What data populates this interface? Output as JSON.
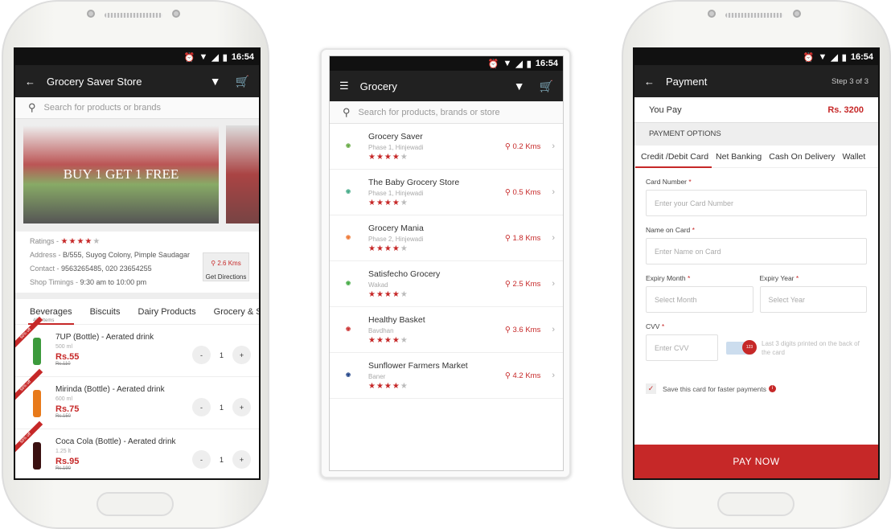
{
  "status_time": "16:54",
  "colors": {
    "accent": "#c62828",
    "appbar": "#212121"
  },
  "store_screen": {
    "title": "Grocery Saver Store",
    "search_placeholder": "Search for products or brands",
    "banner_text": "BUY 1 GET 1 FREE",
    "ratings_label": "Ratings",
    "rating": 4,
    "address_label": "Address",
    "address": "B/555, Suyog Colony, Pimple Saudagar",
    "contact_label": "Contact",
    "contact": "9563265485, 020 23654255",
    "timings_label": "Shop Timings",
    "timings": "9:30 am to 10:00 pm",
    "distance": "2.6 Kms",
    "directions": "Get Directions",
    "tabs": [
      "Beverages",
      "Biscuits",
      "Dairy Products",
      "Grocery & S"
    ],
    "active_tab_count": "400 Items",
    "products": [
      {
        "name": "7UP (Bottle) - Aerated drink",
        "qty": "500 ml",
        "price": "Rs.55",
        "old": "Rs.110",
        "badge": "50% off",
        "count": "1",
        "color": "#3c9a3c"
      },
      {
        "name": "Mirinda (Bottle) - Aerated drink",
        "qty": "600 ml",
        "price": "Rs.75",
        "old": "Rs.150",
        "badge": "50% off",
        "count": "1",
        "color": "#e87a1a"
      },
      {
        "name": "Coca Cola (Bottle) - Aerated drink",
        "qty": "1.25 lt",
        "price": "Rs.95",
        "old": "Rs.190",
        "badge": "50% off",
        "count": "1",
        "color": "#3a1010"
      }
    ],
    "minus": "-",
    "plus": "+"
  },
  "list_screen": {
    "title": "Grocery",
    "search_placeholder": "Search for products, brands or store",
    "stores": [
      {
        "name": "Grocery Saver",
        "area": "Phase 1, Hinjewadi",
        "distance": "0.2 Kms",
        "rating": 4
      },
      {
        "name": "The Baby Grocery Store",
        "area": "Phase 1, Hinjewadi",
        "distance": "0.5 Kms",
        "rating": 4
      },
      {
        "name": "Grocery Mania",
        "area": "Phase 2, Hinjewadi",
        "distance": "1.8 Kms",
        "rating": 4
      },
      {
        "name": "Satisfecho Grocery",
        "area": "Wakad",
        "distance": "2.5 Kms",
        "rating": 4
      },
      {
        "name": "Healthy Basket",
        "area": "Bavdhan",
        "distance": "3.6 Kms",
        "rating": 4
      },
      {
        "name": "Sunflower Farmers Market",
        "area": "Baner",
        "distance": "4.2 Kms",
        "rating": 4
      }
    ]
  },
  "payment_screen": {
    "title": "Payment",
    "step": "Step 3 of 3",
    "you_pay_label": "You Pay",
    "amount": "Rs. 3200",
    "options_label": "PAYMENT OPTIONS",
    "tabs": [
      "Credit /Debit Card",
      "Net Banking",
      "Cash On Delivery",
      "Wallet"
    ],
    "card_number_label": "Card Number",
    "card_number_placeholder": "Enter your Card Number",
    "name_label": "Name on Card",
    "name_placeholder": "Enter Name on Card",
    "month_label": "Expiry Month",
    "month_placeholder": "Select Month",
    "year_label": "Expiry Year",
    "year_placeholder": "Select Year",
    "cvv_label": "CVV",
    "cvv_placeholder": "Enter CVV",
    "cvv_hint": "Last 3 digits printed on the back of the card",
    "cvv_card_digits": "123",
    "save_card": "Save this card for faster payments",
    "save_checked": true,
    "pay_button": "PAY NOW",
    "required": "*"
  }
}
